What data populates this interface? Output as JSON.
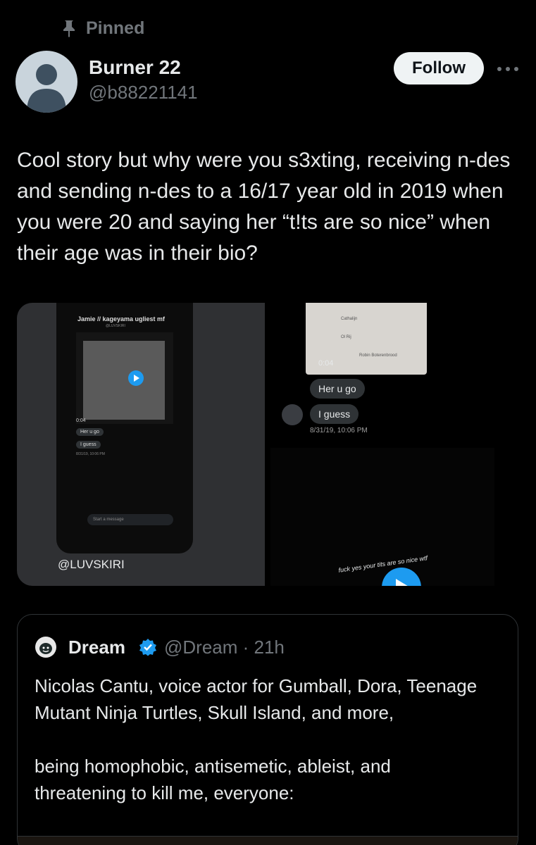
{
  "pinned": {
    "label": "Pinned"
  },
  "author": {
    "name": "Burner 22",
    "handle": "@b88221141",
    "follow_label": "Follow"
  },
  "tweet": {
    "text": "Cool story but why were you s3xting, receiving n-des and sending n-des to a 16/17 year old in 2019 when you were 20 and saying her “t!ts are so nice” when their age was in their bio?"
  },
  "media": {
    "left": {
      "phone_title": "Jamie // kageyama ugliest mf",
      "phone_sub": "@LUVSKIRI",
      "time": "0:04",
      "bubble1": "Her u go",
      "bubble2": "I guess",
      "date": "8/31/19, 10:06 PM",
      "input_placeholder": "Start a message",
      "watermark": "@LUVSKIRI"
    },
    "right": {
      "contacts": [
        "Cathalijn",
        "Ol Rij",
        "Robin Boterenbrood"
      ],
      "time": "0:04",
      "bubble1": "Her u go",
      "bubble2": "I guess",
      "date": "8/31/19, 10:06 PM",
      "caption": "fuck yes your tits are so nice wtf"
    }
  },
  "quote": {
    "name": "Dream",
    "handle_time": "@Dream · 21h",
    "text": "Nicolas Cantu, voice actor for Gumball, Dora, Teenage Mutant Ninja Turtles, Skull Island, and more,\n\nbeing homophobic, antisemetic, ableist, and threatening to kill me, everyone:"
  },
  "colors": {
    "background": "#000000",
    "text_primary": "#e7e9ea",
    "text_secondary": "#71767b",
    "accent": "#1d9bf0",
    "border": "#2f3336"
  }
}
